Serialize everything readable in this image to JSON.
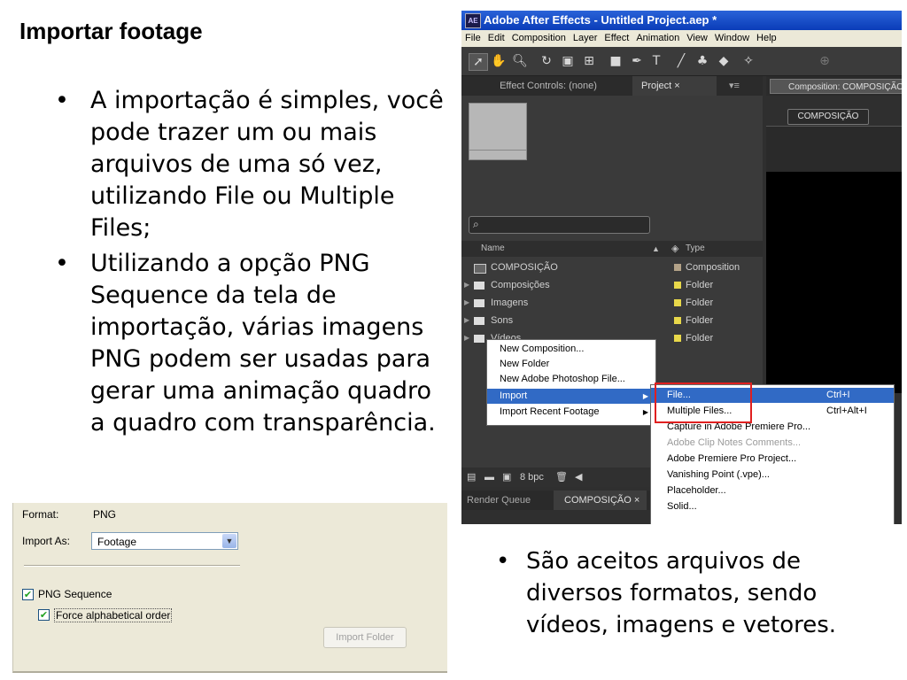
{
  "slide": {
    "title": "Importar footage",
    "bullets": [
      "A importação é simples, você pode trazer um ou mais arquivos de uma só vez, utilizando File ou Multiple Files;",
      "Utilizando a opção PNG Sequence da tela de importação, várias imagens PNG podem ser usadas para gerar uma animação quadro a quadro com transparência."
    ],
    "bullets2": [
      "São aceitos arquivos de diversos formatos, sendo vídeos, imagens e vetores."
    ]
  },
  "ae": {
    "logo": "AE",
    "window_title": "Adobe After Effects - Untitled Project.aep *",
    "menu": [
      "File",
      "Edit",
      "Composition",
      "Layer",
      "Effect",
      "Animation",
      "View",
      "Window",
      "Help"
    ],
    "tabs": {
      "effect_controls": "Effect Controls: (none)",
      "project": "Project ×",
      "composition": "Composition: COMPOSIÇÃO"
    },
    "comp_button": "COMPOSIÇÃO",
    "columns": {
      "name": "Name",
      "type": "Type"
    },
    "rows": [
      {
        "name": "COMPOSIÇÃO",
        "type": "Composition",
        "label_color": "#b3a288"
      },
      {
        "name": "Composições",
        "type": "Folder",
        "label_color": "#e8d84a"
      },
      {
        "name": "Imagens",
        "type": "Folder",
        "label_color": "#e8d84a"
      },
      {
        "name": "Sons",
        "type": "Folder",
        "label_color": "#e8d84a"
      },
      {
        "name": "Vídeos",
        "type": "Folder",
        "label_color": "#e8d84a"
      }
    ],
    "context_menu": [
      "New Composition...",
      "New Folder",
      "New Adobe Photoshop File...",
      "Import",
      "Import Recent Footage"
    ],
    "submenu": [
      {
        "label": "File...",
        "shortcut": "Ctrl+I"
      },
      {
        "label": "Multiple Files...",
        "shortcut": "Ctrl+Alt+I"
      },
      {
        "label": "Capture in Adobe Premiere Pro...",
        "shortcut": ""
      },
      {
        "label": "Adobe Clip Notes Comments...",
        "shortcut": ""
      },
      {
        "label": "Adobe Premiere Pro Project...",
        "shortcut": ""
      },
      {
        "label": "Vanishing Point (.vpe)...",
        "shortcut": ""
      },
      {
        "label": "Placeholder...",
        "shortcut": ""
      },
      {
        "label": "Solid...",
        "shortcut": ""
      }
    ],
    "footer_bpc": "8 bpc",
    "bottom_tabs": {
      "render_queue": "Render Queue",
      "composition": "COMPOSIÇÃO ×"
    }
  },
  "dialog": {
    "format_label": "Format:",
    "format_value": "PNG",
    "import_as_label": "Import As:",
    "import_as_value": "Footage",
    "png_sequence": "PNG Sequence",
    "force_alpha": "Force alphabetical order",
    "import_folder": "Import Folder"
  }
}
